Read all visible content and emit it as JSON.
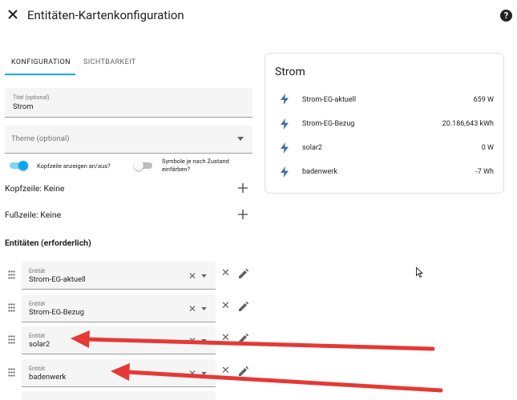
{
  "header": {
    "title": "Entitäten-Kartenkonfiguration",
    "help": "?"
  },
  "tabs": [
    {
      "label": "KONFIGURATION",
      "active": true
    },
    {
      "label": "SICHTBARKEIT",
      "active": false
    }
  ],
  "form": {
    "title_label": "Titel (optional)",
    "title_value": "Strom",
    "theme_placeholder": "Theme (optional)",
    "toggle1_label": "Kopfzeile anzeigen an/aus?",
    "toggle1_on": true,
    "toggle2_label_line1": "Symbole je nach Zustand",
    "toggle2_label_line2": "einfärben?",
    "toggle2_on": false,
    "header_row": "Kopfzeile: Keine",
    "footer_row": "Fußzeile: Keine",
    "entities_heading": "Entitäten (erforderlich)",
    "entity_field_label": "Entität",
    "entities": [
      "Strom-EG-aktuell",
      "Strom-EG-Bezug",
      "solar2",
      "badenwerk"
    ]
  },
  "preview": {
    "title": "Strom",
    "rows": [
      {
        "name": "Strom-EG-aktuell",
        "value": "659 W"
      },
      {
        "name": "Strom-EG-Bezug",
        "value": "20.186,643 kWh"
      },
      {
        "name": "solar2",
        "value": "0 W"
      },
      {
        "name": "badenwerk",
        "value": "-7 Wh"
      }
    ]
  },
  "colors": {
    "accent": "#03a9f4",
    "icon": "#44739e",
    "annotation_arrow": "#e53935"
  }
}
